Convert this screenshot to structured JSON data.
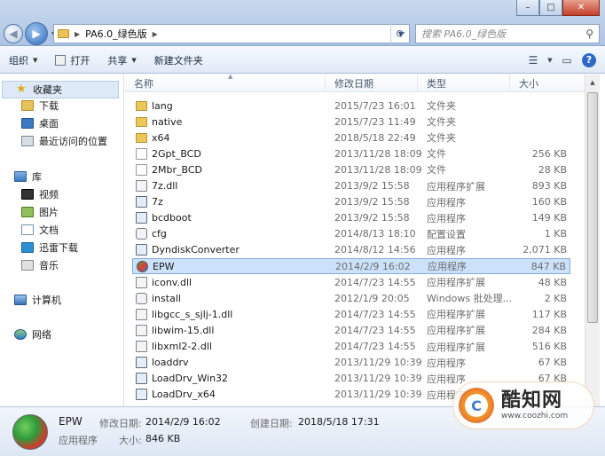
{
  "window": {
    "minimize_glyph": "–",
    "maximize_glyph": "□",
    "close_glyph": "✕"
  },
  "address": {
    "crumbs": [
      "PA6.0_绿色版"
    ],
    "search_placeholder": "搜索 PA6.0_绿色版"
  },
  "toolbar": {
    "organize": "组织",
    "open": "打开",
    "share": "共享",
    "new_folder": "新建文件夹"
  },
  "sidebar": {
    "favorites": "收藏夹",
    "downloads": "下载",
    "desktop": "桌面",
    "recent": "最近访问的位置",
    "libraries": "库",
    "videos": "视频",
    "pictures": "图片",
    "documents": "文档",
    "xunlei": "迅雷下载",
    "music": "音乐",
    "computer": "计算机",
    "network": "网络"
  },
  "columns": {
    "name": "名称",
    "modified": "修改日期",
    "type": "类型",
    "size": "大小"
  },
  "files": [
    {
      "name": "lang",
      "date": "2015/7/23 16:01",
      "type": "文件夹",
      "size": "",
      "icon": "folder"
    },
    {
      "name": "native",
      "date": "2015/7/23 11:49",
      "type": "文件夹",
      "size": "",
      "icon": "folder"
    },
    {
      "name": "x64",
      "date": "2018/5/18 22:49",
      "type": "文件夹",
      "size": "",
      "icon": "folder"
    },
    {
      "name": "2Gpt_BCD",
      "date": "2013/11/28 18:09",
      "type": "文件",
      "size": "256 KB",
      "icon": "file"
    },
    {
      "name": "2Mbr_BCD",
      "date": "2013/11/28 18:09",
      "type": "文件",
      "size": "28 KB",
      "icon": "file"
    },
    {
      "name": "7z.dll",
      "date": "2013/9/2 15:58",
      "type": "应用程序扩展",
      "size": "893 KB",
      "icon": "dll"
    },
    {
      "name": "7z",
      "date": "2013/9/2 15:58",
      "type": "应用程序",
      "size": "160 KB",
      "icon": "exe"
    },
    {
      "name": "bcdboot",
      "date": "2013/9/2 15:58",
      "type": "应用程序",
      "size": "149 KB",
      "icon": "exe"
    },
    {
      "name": "cfg",
      "date": "2014/8/13 18:10",
      "type": "配置设置",
      "size": "1 KB",
      "icon": "cfg"
    },
    {
      "name": "DyndiskConverter",
      "date": "2014/8/12 14:56",
      "type": "应用程序",
      "size": "2,071 KB",
      "icon": "exe"
    },
    {
      "name": "EPW",
      "date": "2014/2/9 16:02",
      "type": "应用程序",
      "size": "847 KB",
      "icon": "app"
    },
    {
      "name": "iconv.dll",
      "date": "2014/7/23 14:55",
      "type": "应用程序扩展",
      "size": "48 KB",
      "icon": "dll"
    },
    {
      "name": "install",
      "date": "2012/1/9 20:05",
      "type": "Windows 批处理...",
      "size": "2 KB",
      "icon": "cfg"
    },
    {
      "name": "libgcc_s_sjlj-1.dll",
      "date": "2014/7/23 14:55",
      "type": "应用程序扩展",
      "size": "117 KB",
      "icon": "dll"
    },
    {
      "name": "libwim-15.dll",
      "date": "2014/7/23 14:55",
      "type": "应用程序扩展",
      "size": "284 KB",
      "icon": "dll"
    },
    {
      "name": "libxml2-2.dll",
      "date": "2014/7/23 14:55",
      "type": "应用程序扩展",
      "size": "516 KB",
      "icon": "dll"
    },
    {
      "name": "loaddrv",
      "date": "2013/11/29 10:39",
      "type": "应用程序",
      "size": "67 KB",
      "icon": "exe"
    },
    {
      "name": "LoadDrv_Win32",
      "date": "2013/11/29 10:39",
      "type": "应用程序",
      "size": "67 KB",
      "icon": "exe"
    },
    {
      "name": "LoadDrv_x64",
      "date": "2013/11/29 10:39",
      "type": "应用程序",
      "size": "",
      "icon": "exe"
    }
  ],
  "selected_index": 10,
  "details": {
    "name": "EPW",
    "type": "应用程序",
    "modified_label": "修改日期:",
    "modified_value": "2014/2/9 16:02",
    "created_label": "创建日期:",
    "created_value": "2018/5/18 17:31",
    "size_label": "大小:",
    "size_value": "846 KB"
  },
  "watermark": {
    "title": "酷知网",
    "url": "www.coozhi.com",
    "logo_letter": "C"
  }
}
